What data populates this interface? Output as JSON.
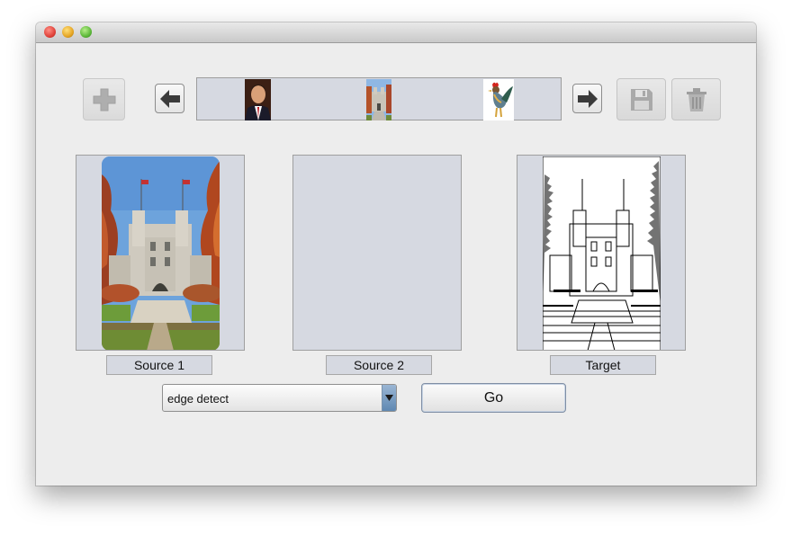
{
  "window": {
    "controls": [
      "close",
      "minimize",
      "zoom"
    ]
  },
  "toolbar": {
    "add_icon": "plus-icon",
    "prev_icon": "arrow-left-icon",
    "next_icon": "arrow-right-icon",
    "save_icon": "floppy-disk-icon",
    "delete_icon": "trash-can-icon"
  },
  "filmstrip": {
    "thumbnails": [
      "portrait photo",
      "university building photo",
      "rooster photo"
    ]
  },
  "panels": {
    "source1": {
      "caption": "Source 1",
      "image": "university building photo"
    },
    "source2": {
      "caption": "Source 2"
    },
    "target": {
      "caption": "Target",
      "image": "edge detected building"
    }
  },
  "controls": {
    "operation_selected": "edge detect",
    "go_label": "Go"
  },
  "colors": {
    "window_bg": "#ededed",
    "panel_bg": "#d6d9e1",
    "combo_arrow": "#6f94bd"
  }
}
